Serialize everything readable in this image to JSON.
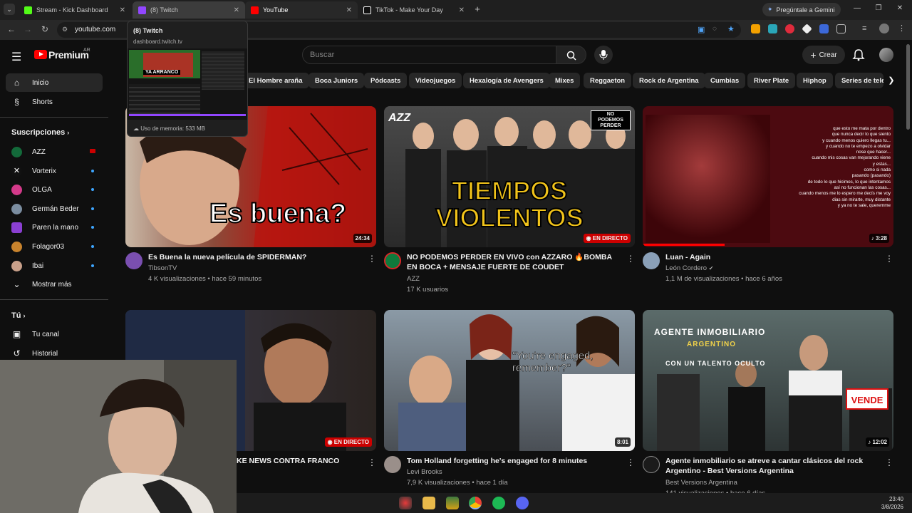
{
  "browser": {
    "tabs": [
      {
        "title": "Stream - Kick Dashboard",
        "color": "#53fc18"
      },
      {
        "title": "(8) Twitch",
        "color": "#9146ff"
      },
      {
        "title": "YouTube",
        "color": "#ff0000"
      },
      {
        "title": "TikTok - Make Your Day",
        "color": "#ffffff"
      }
    ],
    "url": "youtube.com",
    "gemini_label": "Pregúntale a Gemini"
  },
  "tab_preview": {
    "title": "(8) Twitch",
    "url": "dashboard.twitch.tv",
    "memory": "Uso de memoria: 533 MB",
    "thumb_caption": "YA ARRANCO"
  },
  "header": {
    "logo": "Premium",
    "country": "AR",
    "search_placeholder": "Buscar",
    "create_label": "Crear"
  },
  "chips": [
    "El Hombre araña",
    "Boca Juniors",
    "Pódcasts",
    "Videojuegos",
    "Hexalogía de Avengers",
    "Mixes",
    "Reggaeton",
    "Rock de Argentina",
    "Cumbias",
    "River Plate",
    "Hiphop",
    "Series de telev"
  ],
  "sidebar": {
    "home": "Inicio",
    "shorts": "Shorts",
    "subs_header": "Suscripciones",
    "subscriptions": [
      {
        "name": "AZZ",
        "live": true
      },
      {
        "name": "Vorterix",
        "live": false
      },
      {
        "name": "OLGA",
        "live": false
      },
      {
        "name": "Germán Beder",
        "live": false
      },
      {
        "name": "Paren la mano",
        "live": false
      },
      {
        "name": "Folagor03",
        "live": false
      },
      {
        "name": "Ibai",
        "live": false
      }
    ],
    "show_more": "Mostrar más",
    "you_header": "Tú",
    "your_channel": "Tu canal",
    "history": "Historial"
  },
  "videos": [
    {
      "title": "Es Buena la nueva película de SPIDERMAN?",
      "channel": "TibsonTV",
      "meta": "4 K visualizaciones • hace 59 minutos",
      "duration": "24:34",
      "thumb_text": "Es buena?",
      "thumb_color": "#9a1d12"
    },
    {
      "title": "NO PODEMOS PERDER EN VIVO con AZZARO 🔥BOMBA EN BOCA + MENSAJE FUERTE DE COUDET",
      "channel": "AZZ",
      "meta": "17 K usuarios",
      "badge": "EN DIRECTO",
      "thumb_text": "TIEMPOS VIOLENTOS",
      "thumb_color": "#3a3a3a",
      "corner_text": "NO PODEMOS PERDER",
      "logo_text": "AZZ"
    },
    {
      "title": "Luan - Again",
      "channel": "León Cordero",
      "meta": "1,1 M de visualizaciones • hace 6 años",
      "duration": "3:28",
      "thumb_color": "#5c0c12",
      "lyrics": [
        "que esto me mata por dentro",
        "que nunca decir lo que siento",
        "y cuando menos quiero llegas tu...",
        "y cuando no te empezo a olvidar",
        "nose que hacer...",
        "cuando mis cosas van mejorando viene",
        "y estas...",
        "como si nada",
        "pasando (pasando)",
        "de todo lo que hicimos, lo que intentamos",
        "así no funcionan las cosas...",
        "cuando menos me lo espero me decís me voy",
        "dias sin mirarte, muy distante",
        "y ya no te sale, queremme"
      ]
    },
    {
      "title": "KE NEWS CONTRA FRANCO",
      "channel": "",
      "meta": "",
      "badge": "EN DIRECTO",
      "thumb_color": "#2a2320"
    },
    {
      "title": "Tom Holland forgetting he's engaged for 8 minutes",
      "channel": "Levi Brooks",
      "meta": "7,9 K visualizaciones • hace 1 día",
      "duration": "8:01",
      "thumb_text": "\"You're engaged, remember?\"",
      "thumb_color": "#6b6f73"
    },
    {
      "title": "Agente inmobiliario se atreve a cantar clásicos del rock Argentino - Best Versions Argentina",
      "channel": "Best Versions Argentina",
      "meta": "141 visualizaciones • hace 6 días",
      "duration": "12:02",
      "thumb_color": "#3b4848",
      "overlay_lines": [
        "AGENTE INMOBILIARIO",
        "ARGENTINO",
        "CON UN TALENTO OCULTO"
      ],
      "sign_text": "VENDE"
    }
  ],
  "taskbar": {
    "time": "23:40",
    "date": "3/8/2026"
  }
}
